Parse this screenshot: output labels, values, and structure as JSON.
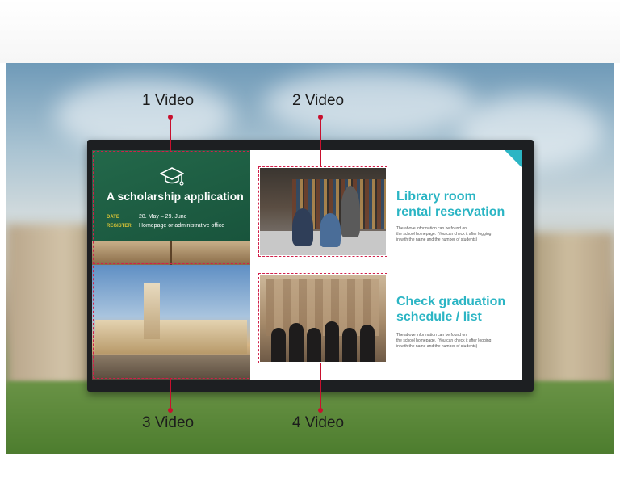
{
  "callouts": {
    "v1": "1 Video",
    "v2": "2 Video",
    "v3": "3 Video",
    "v4": "4 Video"
  },
  "zone1": {
    "title": "A scholarship application",
    "date_label": "DATE",
    "date_value": "28. May – 29. June",
    "register_label": "REGISTER",
    "register_value": "Homepage or administrative office"
  },
  "zone2": {
    "title_line1": "Library room",
    "title_line2": "rental reservation",
    "note_line1": "The above information can be found on",
    "note_line2": "the school homepage. (You can check it after logging",
    "note_line3": "in with the name and the number of students)"
  },
  "zone4": {
    "title_line1": "Check graduation",
    "title_line2": "schedule / list",
    "note_line1": "The above information can be found on",
    "note_line2": "the school homepage. (You can check it after logging",
    "note_line3": "in with the name and the number of students)"
  },
  "colors": {
    "accent_teal": "#2bb5c4",
    "callout_red": "#c8102e",
    "zone1_green": "#1f5f44",
    "label_yellow": "#d7c236"
  },
  "icons": {
    "zone1_icon": "graduation-cap-icon"
  }
}
